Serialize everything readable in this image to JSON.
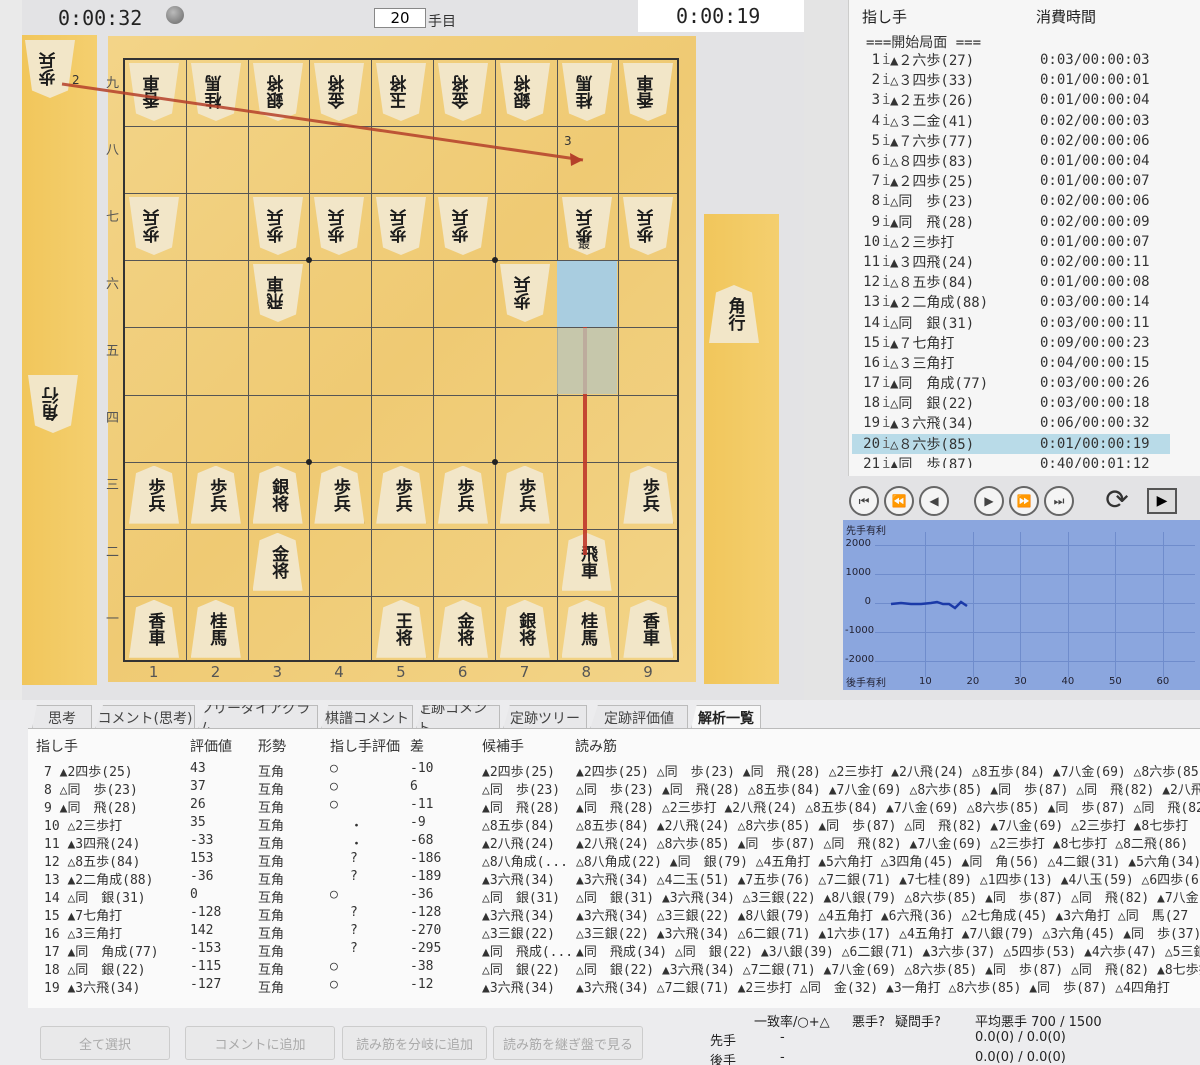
{
  "clocks": {
    "sente_time": "0:00:32",
    "gote_time": "0:00:19",
    "move_number": "20",
    "move_suffix": "手目"
  },
  "board": {
    "files": [
      "1",
      "2",
      "3",
      "4",
      "5",
      "6",
      "7",
      "8",
      "9"
    ],
    "ranks": [
      "九",
      "八",
      "七",
      "六",
      "五",
      "四",
      "三",
      "二",
      "一"
    ],
    "pieces": [
      {
        "t": "香車",
        "c": 0,
        "r": 0,
        "rev": true
      },
      {
        "t": "桂馬",
        "c": 1,
        "r": 0,
        "rev": true
      },
      {
        "t": "銀将",
        "c": 2,
        "r": 0,
        "rev": true
      },
      {
        "t": "金将",
        "c": 3,
        "r": 0,
        "rev": true
      },
      {
        "t": "玉将",
        "c": 4,
        "r": 0,
        "rev": true
      },
      {
        "t": "金将",
        "c": 5,
        "r": 0,
        "rev": true
      },
      {
        "t": "銀将",
        "c": 6,
        "r": 0,
        "rev": true
      },
      {
        "t": "桂馬",
        "c": 7,
        "r": 0,
        "rev": true
      },
      {
        "t": "香車",
        "c": 8,
        "r": 0,
        "rev": true
      },
      {
        "t": "歩兵",
        "c": 0,
        "r": 2,
        "rev": true
      },
      {
        "t": "歩兵",
        "c": 2,
        "r": 2,
        "rev": true
      },
      {
        "t": "歩兵",
        "c": 3,
        "r": 2,
        "rev": true
      },
      {
        "t": "歩兵",
        "c": 4,
        "r": 2,
        "rev": true
      },
      {
        "t": "歩兵",
        "c": 5,
        "r": 2,
        "rev": true
      },
      {
        "t": "歩兵",
        "c": 7,
        "r": 2,
        "rev": true
      },
      {
        "t": "歩兵",
        "c": 8,
        "r": 2,
        "rev": true
      },
      {
        "t": "飛車",
        "c": 2,
        "r": 3,
        "rev": true
      },
      {
        "t": "歩兵",
        "c": 6,
        "r": 3,
        "rev": true
      },
      {
        "t": "歩兵",
        "c": 7,
        "r": 3,
        "rev": true
      },
      {
        "t": "歩兵",
        "c": 0,
        "r": 6,
        "rev": false
      },
      {
        "t": "歩兵",
        "c": 1,
        "r": 6,
        "rev": false
      },
      {
        "t": "銀将",
        "c": 2,
        "r": 6,
        "rev": false
      },
      {
        "t": "歩兵",
        "c": 3,
        "r": 6,
        "rev": false
      },
      {
        "t": "歩兵",
        "c": 4,
        "r": 6,
        "rev": false
      },
      {
        "t": "歩兵",
        "c": 5,
        "r": 6,
        "rev": false
      },
      {
        "t": "歩兵",
        "c": 6,
        "r": 6,
        "rev": false
      },
      {
        "t": "歩兵",
        "c": 8,
        "r": 6,
        "rev": false
      },
      {
        "t": "金将",
        "c": 2,
        "r": 7,
        "rev": false
      },
      {
        "t": "飛車",
        "c": 7,
        "r": 7,
        "rev": false
      },
      {
        "t": "香車",
        "c": 0,
        "r": 8,
        "rev": false
      },
      {
        "t": "桂馬",
        "c": 1,
        "r": 8,
        "rev": false
      },
      {
        "t": "王将",
        "c": 4,
        "r": 8,
        "rev": false
      },
      {
        "t": "金将",
        "c": 5,
        "r": 8,
        "rev": false
      },
      {
        "t": "銀将",
        "c": 6,
        "r": 8,
        "rev": false
      },
      {
        "t": "桂馬",
        "c": 7,
        "r": 8,
        "rev": false
      },
      {
        "t": "香車",
        "c": 8,
        "r": 8,
        "rev": false
      }
    ],
    "arrow_labels": [
      "2",
      "3",
      "最",
      "2"
    ]
  },
  "hands": {
    "gote_top": "歩兵",
    "gote_left": "角行",
    "sente": "角行"
  },
  "movelist": {
    "header_move": "指し手",
    "header_time": "消費時間",
    "start": "===開始局面 ===",
    "rows": [
      {
        "n": "1",
        "mv": "▲２六歩(27)",
        "t": "0:03/00:00:03"
      },
      {
        "n": "2",
        "mv": "△３四歩(33)",
        "t": "0:01/00:00:01"
      },
      {
        "n": "3",
        "mv": "▲２五歩(26)",
        "t": "0:01/00:00:04"
      },
      {
        "n": "4",
        "mv": "△３二金(41)",
        "t": "0:02/00:00:03"
      },
      {
        "n": "5",
        "mv": "▲７六歩(77)",
        "t": "0:02/00:00:06"
      },
      {
        "n": "6",
        "mv": "△８四歩(83)",
        "t": "0:01/00:00:04"
      },
      {
        "n": "7",
        "mv": "▲２四歩(25)",
        "t": "0:01/00:00:07"
      },
      {
        "n": "8",
        "mv": "△同　歩(23)",
        "t": "0:02/00:00:06"
      },
      {
        "n": "9",
        "mv": "▲同　飛(28)",
        "t": "0:02/00:00:09"
      },
      {
        "n": "10",
        "mv": "△２三歩打",
        "t": "0:01/00:00:07"
      },
      {
        "n": "11",
        "mv": "▲３四飛(24)",
        "t": "0:02/00:00:11"
      },
      {
        "n": "12",
        "mv": "△８五歩(84)",
        "t": "0:01/00:00:08"
      },
      {
        "n": "13",
        "mv": "▲２二角成(88)",
        "t": "0:03/00:00:14"
      },
      {
        "n": "14",
        "mv": "△同　銀(31)",
        "t": "0:03/00:00:11"
      },
      {
        "n": "15",
        "mv": "▲７七角打",
        "t": "0:09/00:00:23"
      },
      {
        "n": "16",
        "mv": "△３三角打",
        "t": "0:04/00:00:15"
      },
      {
        "n": "17",
        "mv": "▲同　角成(77)",
        "t": "0:03/00:00:26"
      },
      {
        "n": "18",
        "mv": "△同　銀(22)",
        "t": "0:03/00:00:18"
      },
      {
        "n": "19",
        "mv": "▲３六飛(34)",
        "t": "0:06/00:00:32"
      },
      {
        "n": "20",
        "mv": "△８六歩(85)",
        "t": "0:01/00:00:19"
      },
      {
        "n": "21",
        "mv": "▲同　歩(87)",
        "t": "0:40/00:01:12"
      }
    ]
  },
  "eval_graph": {
    "top_label": "先手有利",
    "bottom_label": "後手有利",
    "y_ticks": [
      "2000",
      "1000",
      "0",
      "-1000",
      "-2000"
    ],
    "x_ticks": [
      "10",
      "20",
      "30",
      "40",
      "50",
      "60"
    ]
  },
  "tabs": [
    "思考",
    "コメント(思考)",
    "ツリーダイアグラム",
    "棋譜コメント",
    "定跡コメント",
    "定跡ツリー",
    "定跡評価値",
    "解析一覧"
  ],
  "analysis": {
    "headers": {
      "move": "指し手",
      "value": "評価値",
      "situation": "形勢",
      "rating": "指し手評価",
      "diff": "差",
      "candidate": "候補手",
      "pv": "読み筋"
    },
    "rows": [
      {
        "move": "7 ▲2四歩(25)",
        "value": "43",
        "sit": "互角",
        "rate": "○",
        "diff": "-10",
        "cand": "▲2四歩(25)",
        "pv": "▲2四歩(25) △同　歩(23) ▲同　飛(28) △2三歩打 ▲2八飛(24) △8五歩(84) ▲7八金(69) △8六歩(85)"
      },
      {
        "move": "8 △同　歩(23)",
        "value": "37",
        "sit": "互角",
        "rate": "○",
        "diff": "6",
        "cand": "△同　歩(23)",
        "pv": "△同　歩(23) ▲同　飛(28) △8五歩(84) ▲7八金(69) △8六歩(85) ▲同　歩(87) △同　飛(82) ▲2八飛(2"
      },
      {
        "move": "9 ▲同　飛(28)",
        "value": "26",
        "sit": "互角",
        "rate": "○",
        "diff": "-11",
        "cand": "▲同　飛(28)",
        "pv": "▲同　飛(28) △2三歩打 ▲2八飛(24) △8五歩(84) ▲7八金(69) △8六歩(85) ▲同　歩(87) △同　飛(82)"
      },
      {
        "move": "10 △2三歩打",
        "value": "35",
        "sit": "互角",
        "rate": "・",
        "diff": "-9",
        "cand": "△8五歩(84)",
        "pv": "△8五歩(84) ▲2八飛(24) △8六歩(85) ▲同　歩(87) △同　飛(82) ▲7八金(69) △2三歩打 ▲8七歩打"
      },
      {
        "move": "11 ▲3四飛(24)",
        "value": "-33",
        "sit": "互角",
        "rate": "・",
        "diff": "-68",
        "cand": "▲2八飛(24)",
        "pv": "▲2八飛(24) △8六歩(85) ▲同　歩(87) △同　飛(82) ▲7八金(69) △2三歩打 ▲8七歩打 △8二飛(86)"
      },
      {
        "move": "12 △8五歩(84)",
        "value": "153",
        "sit": "互角",
        "rate": "?",
        "diff": "-186",
        "cand": "△8八角成(...",
        "pv": "△8八角成(22) ▲同　銀(79) △4五角打 ▲5六角打 △3四角(45) ▲同　角(56) △4二銀(31) ▲5六角(34)"
      },
      {
        "move": "13 ▲2二角成(88)",
        "value": "-36",
        "sit": "互角",
        "rate": "?",
        "diff": "-189",
        "cand": "▲3六飛(34)",
        "pv": "▲3六飛(34) △4二玉(51) ▲7五歩(76) △7二銀(71) ▲7七桂(89) △1四歩(13) ▲4八玉(59) △6四歩(6"
      },
      {
        "move": "14 △同　銀(31)",
        "value": "0",
        "sit": "互角",
        "rate": "○",
        "diff": "-36",
        "cand": "△同　銀(31)",
        "pv": "△同　銀(31) ▲3六飛(34) △3三銀(22) ▲8八銀(79) △8六歩(85) ▲同　歩(87) △同　飛(82) ▲7八金(6"
      },
      {
        "move": "15 ▲7七角打",
        "value": "-128",
        "sit": "互角",
        "rate": "?",
        "diff": "-128",
        "cand": "▲3六飛(34)",
        "pv": "▲3六飛(34) △3三銀(22) ▲8八銀(79) △4五角打 ▲6六飛(36) △2七角成(45) ▲3六角打 △同　馬(27"
      },
      {
        "move": "16 △3三角打",
        "value": "142",
        "sit": "互角",
        "rate": "?",
        "diff": "-270",
        "cand": "△3三銀(22)",
        "pv": "△3三銀(22) ▲3六飛(34) △6二銀(71) ▲1六歩(17) △4五角打 ▲7八銀(79) △3六角(45) ▲同　歩(37)"
      },
      {
        "move": "17 ▲同　角成(77)",
        "value": "-153",
        "sit": "互角",
        "rate": "?",
        "diff": "-295",
        "cand": "▲同　飛成(...",
        "pv": "▲同　飛成(34) △同　銀(22) ▲3八銀(39) △6二銀(71) ▲3六歩(37) △5四歩(53) ▲4六歩(47) △5三銀"
      },
      {
        "move": "18 △同　銀(22)",
        "value": "-115",
        "sit": "互角",
        "rate": "○",
        "diff": "-38",
        "cand": "△同　銀(22)",
        "pv": "△同　銀(22) ▲3六飛(34) △7二銀(71) ▲7八金(69) △8六歩(85) ▲同　歩(87) △同　飛(82) ▲8七歩打"
      },
      {
        "move": "19 ▲3六飛(34)",
        "value": "-127",
        "sit": "互角",
        "rate": "○",
        "diff": "-12",
        "cand": "▲3六飛(34)",
        "pv": "▲3六飛(34) △7二銀(71) ▲2三歩打 △同　金(32) ▲3一角打 △8六歩(85) ▲同　歩(87) △4四角打"
      }
    ]
  },
  "buttons": [
    "全て選択",
    "コメントに追加",
    "読み筋を分岐に追加",
    "読み筋を継ぎ盤で見る"
  ],
  "summary": {
    "agree": "一致率/○+△",
    "bad": "悪手?",
    "doubt": "疑問手?",
    "avg": "平均悪手 700 / 1500",
    "sente_label": "先手",
    "gote_label": "後手",
    "dash": "-",
    "sente_val": "0.0(0) / 0.0(0)",
    "gote_val": "0.0(0) / 0.0(0)"
  }
}
